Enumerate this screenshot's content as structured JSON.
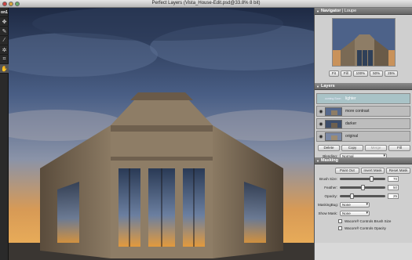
{
  "window": {
    "title": "Perfect Layers (Vista_House-Edit.psd@33.8% 8 bit)"
  },
  "toolbar": {
    "tools": [
      "on1-logo",
      "move-icon",
      "mask-brush-icon",
      "eyedropper-icon",
      "bug-icon",
      "crop-icon",
      "hand-icon"
    ],
    "logo_text": "on1"
  },
  "navigator": {
    "title": "Navigator",
    "alt_tab": "| Loupe",
    "zoom_buttons": [
      "Fit",
      "Fill",
      "100%",
      "50%",
      "25%"
    ]
  },
  "layers": {
    "title": "Layers",
    "items": [
      {
        "name": "lighter",
        "visible": false,
        "selected": true
      },
      {
        "name": "more contrast",
        "visible": true,
        "selected": false
      },
      {
        "name": "darker",
        "visible": true,
        "selected": false
      },
      {
        "name": "original",
        "visible": true,
        "selected": false
      }
    ],
    "selected_prefix": "coming Soon",
    "buttons": [
      "Delete",
      "Copy",
      "Merge",
      "Fill"
    ],
    "blending_label": "Blending:",
    "blending_value": "Normal",
    "opacity_label": "Opacity:",
    "opacity_value": "100"
  },
  "masking": {
    "title": "Masking",
    "buttons": [
      "Paint Out",
      "Invert Mask",
      "Reset Mask"
    ],
    "brush_size_label": "Brush Size:",
    "brush_size_value": "70",
    "feather_label": "Feather:",
    "feather_value": "50",
    "opacity_label": "Opacity:",
    "opacity_value": "25",
    "maskingbug_label": "MaskingBug:",
    "maskingbug_value": "None",
    "show_mask_label": "Show Mask:",
    "show_mask_value": "None",
    "check1": "Wacom® Controls Brush Size",
    "check2": "Wacom® Controls Opacity"
  }
}
